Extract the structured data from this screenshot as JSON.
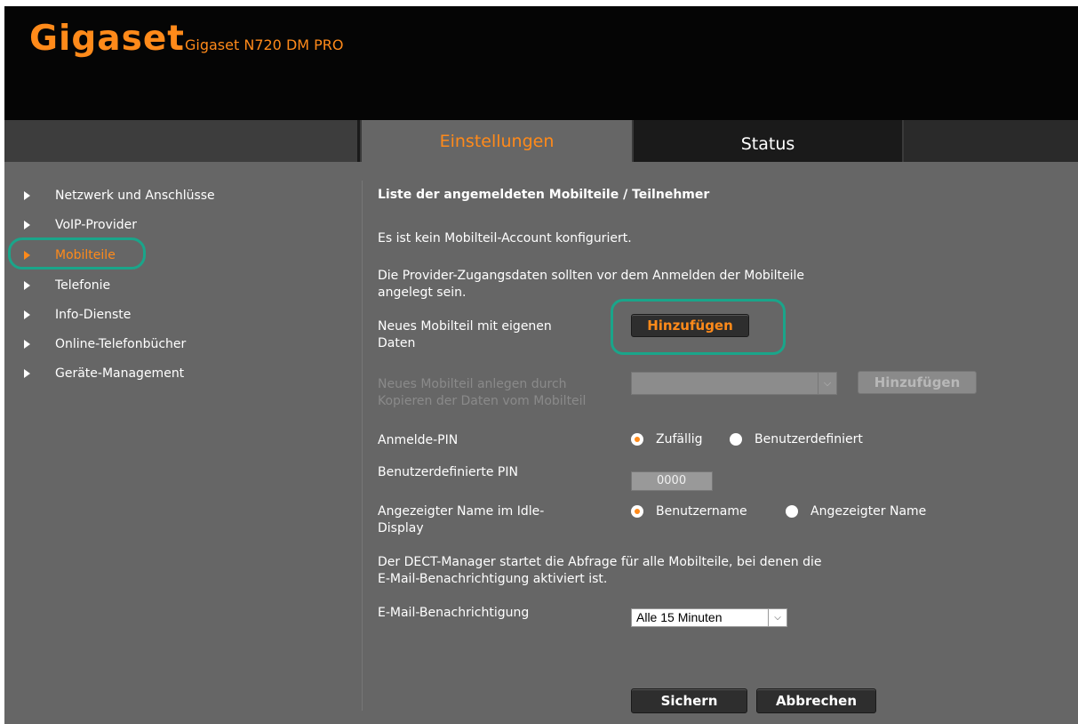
{
  "header": {
    "logo": "Gigaset",
    "model": "Gigaset N720 DM PRO"
  },
  "tabs": [
    {
      "label": "Einstellungen",
      "active": true
    },
    {
      "label": "Status",
      "active": false
    }
  ],
  "sidebar": {
    "items": [
      {
        "label": "Netzwerk und Anschlüsse",
        "active": false
      },
      {
        "label": "VoIP-Provider",
        "active": false
      },
      {
        "label": "Mobilteile",
        "active": true
      },
      {
        "label": "Telefonie",
        "active": false
      },
      {
        "label": "Info-Dienste",
        "active": false
      },
      {
        "label": "Online-Telefonbücher",
        "active": false
      },
      {
        "label": "Geräte-Management",
        "active": false
      }
    ]
  },
  "main": {
    "heading": "Liste der angemeldeten Mobilteile / Teilnehmer",
    "no_account": "Es ist kein Mobilteil-Account konfiguriert.",
    "provider_note_1": "Die Provider-Zugangsdaten sollten vor dem Anmelden der Mobilteile",
    "provider_note_2": "angelegt sein.",
    "new_handset_label_1": "Neues Mobilteil mit eigenen",
    "new_handset_label_2": "Daten",
    "add_button": "Hinzufügen",
    "copy_label_1": "Neues Mobilteil anlegen durch",
    "copy_label_2": "Kopieren der Daten vom Mobilteil",
    "copy_add_button": "Hinzufügen",
    "pin_label": "Anmelde-PIN",
    "pin_opt_random": "Zufällig",
    "pin_opt_custom": "Benutzerdefiniert",
    "custom_pin_label": "Benutzerdefinierte PIN",
    "custom_pin_value": "0000",
    "idle_label_1": "Angezeigter Name im Idle-",
    "idle_label_2": "Display",
    "idle_opt_user": "Benutzername",
    "idle_opt_display": "Angezeigter Name",
    "dect_note_1": "Der DECT-Manager startet die Abfrage für alle Mobilteile, bei denen die",
    "dect_note_2": "E-Mail-Benachrichtigung aktiviert ist.",
    "email_label": "E-Mail-Benachrichtigung",
    "email_value": "Alle 15 Minuten",
    "save_button": "Sichern",
    "cancel_button": "Abbrechen"
  },
  "colors": {
    "accent": "#ff8a1a",
    "highlight": "#1aa58a",
    "panel": "#666666",
    "header_bg": "#050505"
  }
}
